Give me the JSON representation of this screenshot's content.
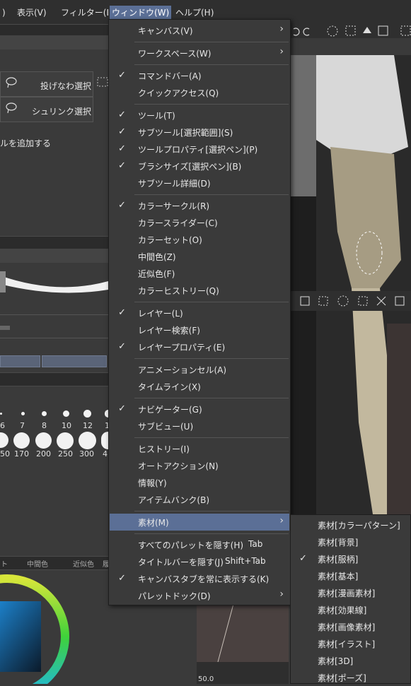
{
  "menubar": {
    "items": [
      {
        "label": ")"
      },
      {
        "label": "表示(V)"
      },
      {
        "label": "フィルター(I)"
      },
      {
        "label": "ウィンドウ(W)"
      },
      {
        "label": "ヘルプ(H)"
      }
    ]
  },
  "tool_panel": {
    "lasso_select": "投げなわ選択",
    "shrink_select": "シュリンク選択",
    "add_tool_text": "ルを追加する"
  },
  "brush_sizes": {
    "row1": [
      "6",
      "7",
      "8",
      "10",
      "12",
      "1"
    ],
    "row2": [
      "50",
      "170",
      "200",
      "250",
      "300",
      "4"
    ]
  },
  "palette_tabs": [
    "ト",
    "中間色",
    "近似色",
    "履"
  ],
  "navigator": {
    "zoom": "50.0"
  },
  "window_menu": {
    "items": [
      {
        "label": "キャンバス(V)",
        "checked": false,
        "submenu": true
      },
      {
        "label": "ワークスペース(W)",
        "checked": false,
        "submenu": true
      },
      {
        "label": "コマンドバー(A)",
        "checked": true
      },
      {
        "label": "クイックアクセス(Q)",
        "checked": false
      },
      {
        "label": "ツール(T)",
        "checked": true
      },
      {
        "label": "サブツール[選択範囲](S)",
        "checked": true
      },
      {
        "label": "ツールプロパティ[選択ペン](P)",
        "checked": true
      },
      {
        "label": "ブラシサイズ[選択ペン](B)",
        "checked": true
      },
      {
        "label": "サブツール詳細(D)",
        "checked": false
      },
      {
        "label": "カラーサークル(R)",
        "checked": true
      },
      {
        "label": "カラースライダー(C)",
        "checked": false
      },
      {
        "label": "カラーセット(O)",
        "checked": false
      },
      {
        "label": "中間色(Z)",
        "checked": false
      },
      {
        "label": "近似色(F)",
        "checked": false
      },
      {
        "label": "カラーヒストリー(Q)",
        "checked": false
      },
      {
        "label": "レイヤー(L)",
        "checked": true
      },
      {
        "label": "レイヤー検索(F)",
        "checked": false
      },
      {
        "label": "レイヤープロパティ(E)",
        "checked": true
      },
      {
        "label": "アニメーションセル(A)",
        "checked": false
      },
      {
        "label": "タイムライン(X)",
        "checked": false
      },
      {
        "label": "ナビゲーター(G)",
        "checked": true
      },
      {
        "label": "サブビュー(U)",
        "checked": false
      },
      {
        "label": "ヒストリー(I)",
        "checked": false
      },
      {
        "label": "オートアクション(N)",
        "checked": false
      },
      {
        "label": "情報(Y)",
        "checked": false
      },
      {
        "label": "アイテムバンク(B)",
        "checked": false
      },
      {
        "label": "素材(M)",
        "checked": false,
        "submenu": true,
        "highlighted": true
      },
      {
        "label": "すべてのパレットを隠す(H)",
        "checked": false,
        "shortcut": "Tab"
      },
      {
        "label": "タイトルバーを隠す(J)",
        "checked": false,
        "shortcut": "Shift+Tab"
      },
      {
        "label": "キャンバスタブを常に表示する(K)",
        "checked": true
      },
      {
        "label": "パレットドック(D)",
        "checked": false,
        "submenu": true
      }
    ]
  },
  "material_submenu": {
    "items": [
      {
        "label": "素材[カラーパターン]",
        "checked": false
      },
      {
        "label": "素材[背景]",
        "checked": false
      },
      {
        "label": "素材[服柄]",
        "checked": true
      },
      {
        "label": "素材[基本]",
        "checked": false
      },
      {
        "label": "素材[漫画素材]",
        "checked": false
      },
      {
        "label": "素材[効果線]",
        "checked": false
      },
      {
        "label": "素材[画像素材]",
        "checked": false
      },
      {
        "label": "素材[イラスト]",
        "checked": false
      },
      {
        "label": "素材[3D]",
        "checked": false
      },
      {
        "label": "素材[ポーズ]",
        "checked": false
      }
    ]
  },
  "glyphs": {
    "check": "✓",
    "arrow": "›"
  },
  "colors": {
    "highlight": "#5b6f96",
    "menu_bg": "#3a3a3a"
  }
}
